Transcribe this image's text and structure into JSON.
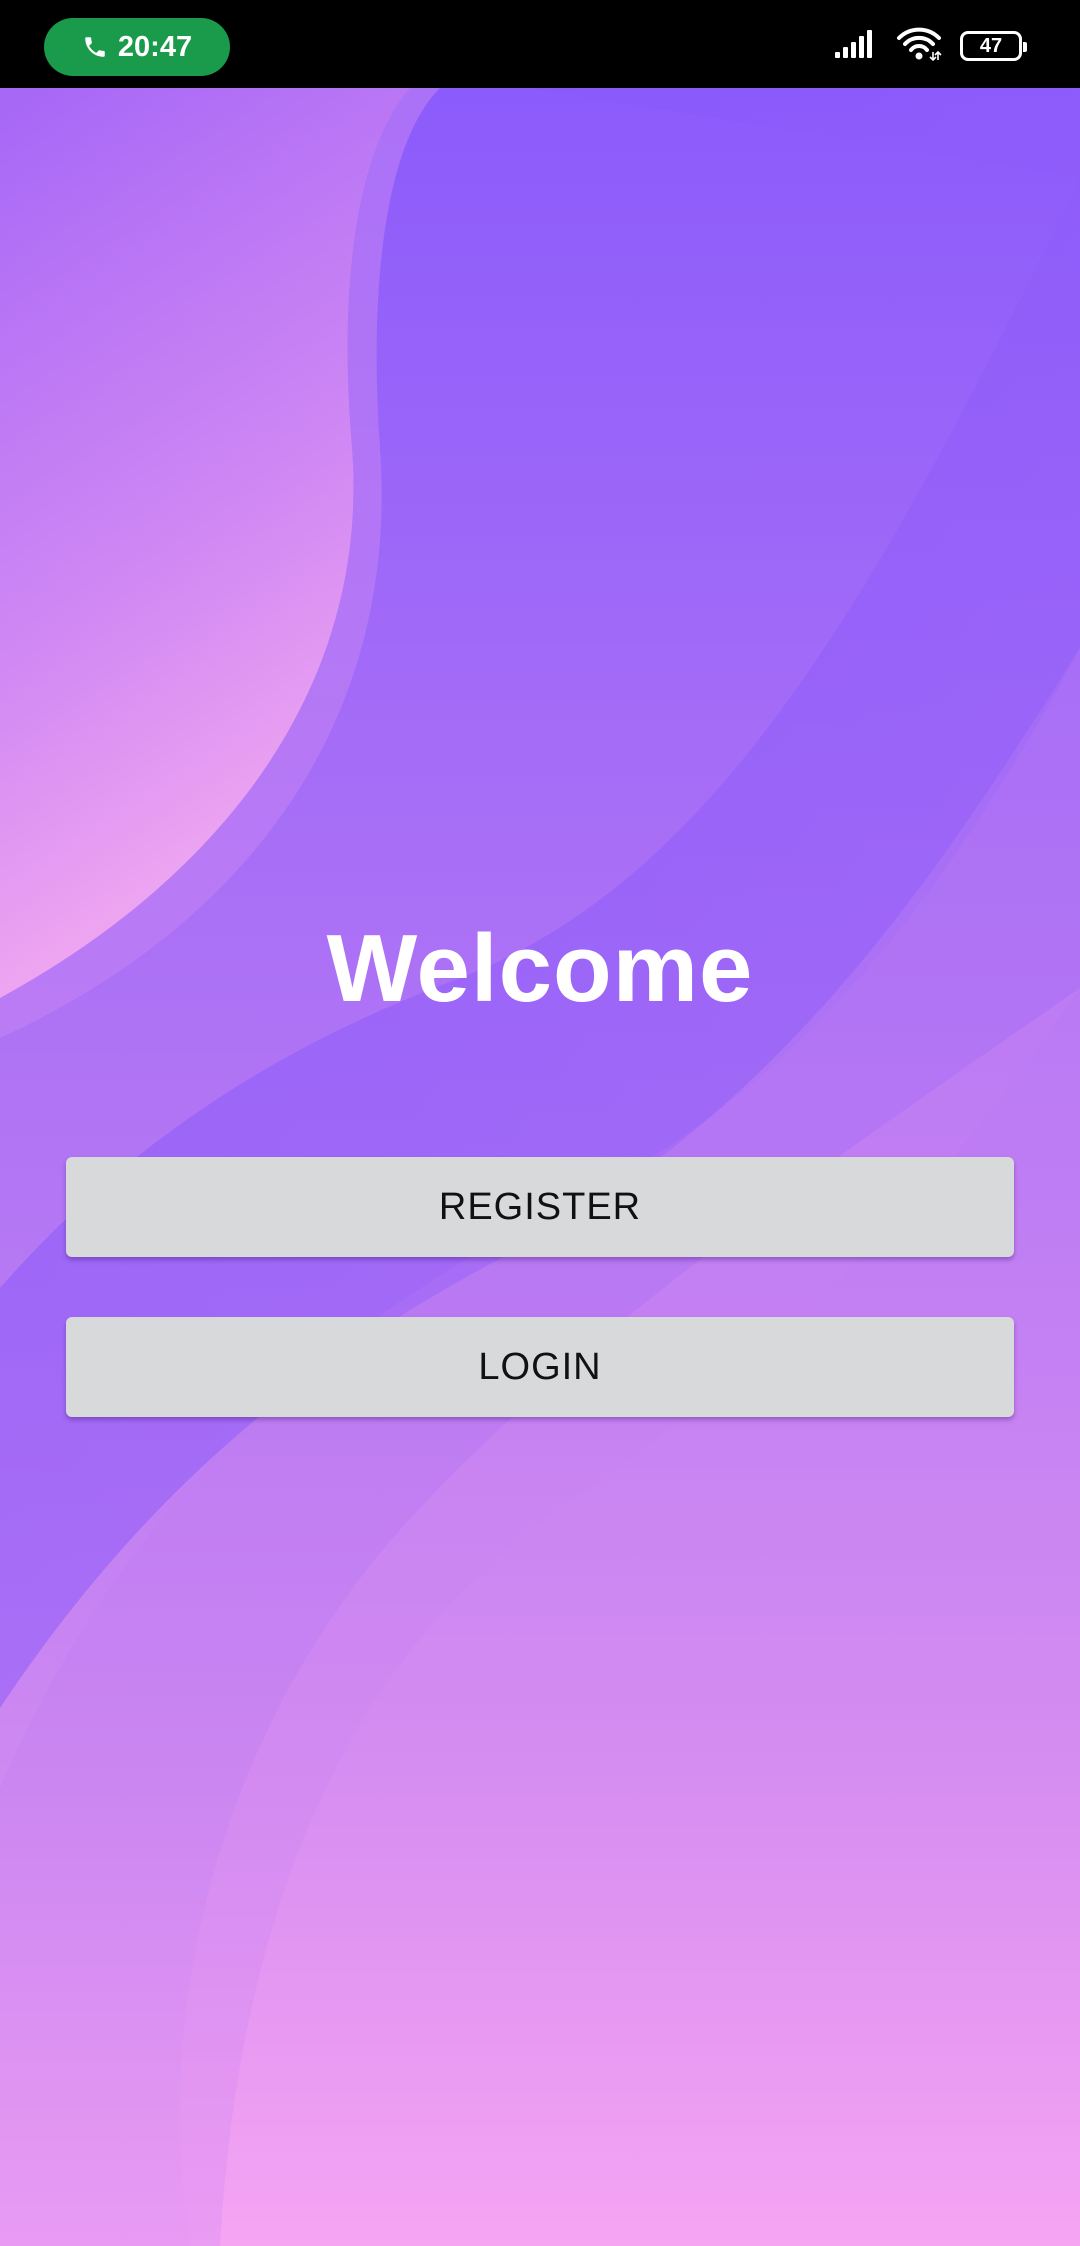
{
  "status_bar": {
    "call_time": "20:47",
    "call_icon": "phone-icon",
    "call_pill_color": "#1a9a4b",
    "signal_icon": "signal-icon",
    "wifi_icon": "wifi-icon",
    "battery_level": "47"
  },
  "welcome": {
    "title": "Welcome"
  },
  "buttons": {
    "register_label": "REGISTER",
    "login_label": "LOGIN"
  },
  "theme": {
    "background_top": "#8c5bfb",
    "background_bottom": "#f7a6f3",
    "button_bg": "#d8d9da",
    "title_color": "#ffffff"
  }
}
